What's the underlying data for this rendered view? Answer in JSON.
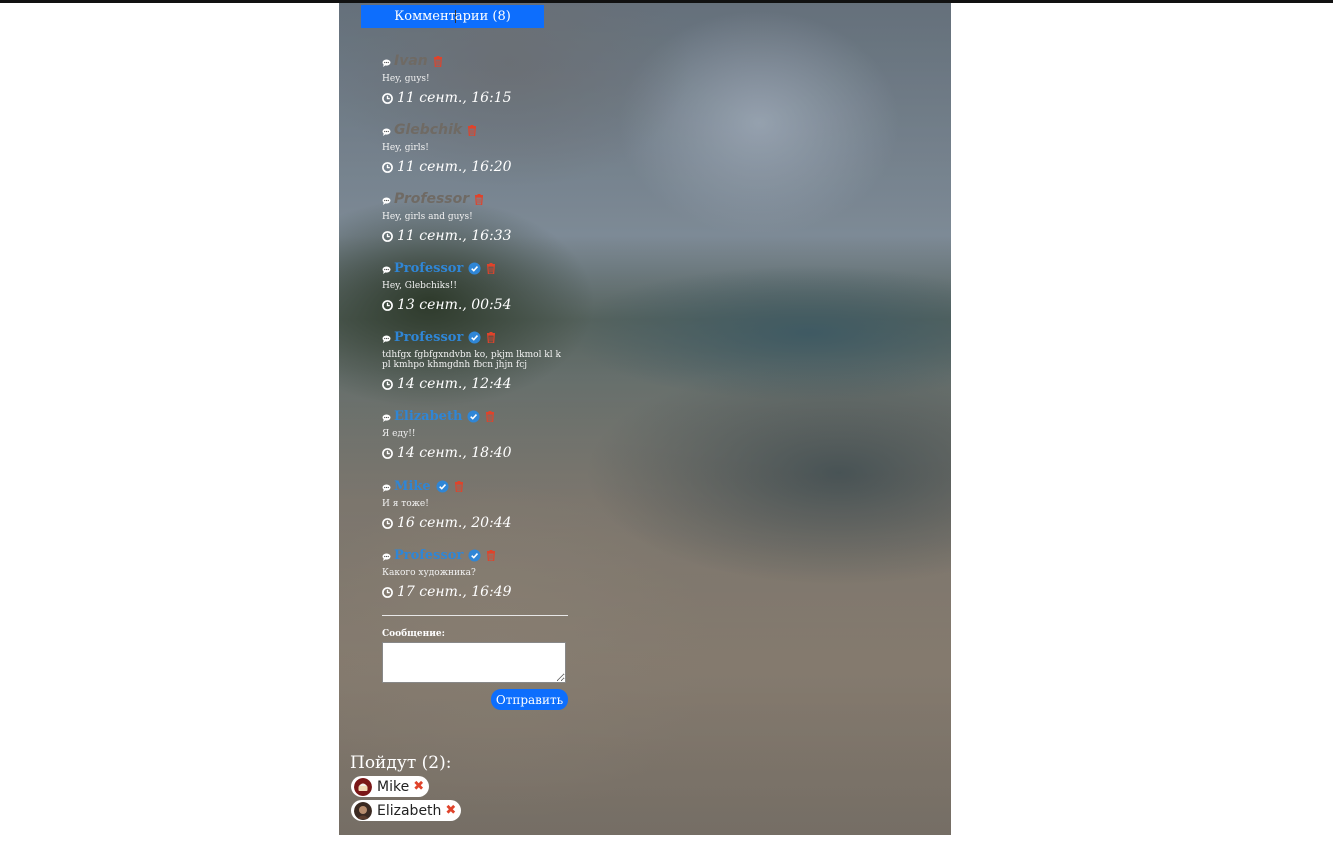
{
  "comments_tab": {
    "label_a": "Коммент",
    "label_b": "арии (8)"
  },
  "comments": [
    {
      "name": "Ivan",
      "verified": false,
      "text": "Hey, guys!",
      "time": "11 сент., 16:15"
    },
    {
      "name": "Glebchik",
      "verified": false,
      "text": "Hey, girls!",
      "time": "11 сент., 16:20"
    },
    {
      "name": "Professor",
      "verified": false,
      "text": "Hey, girls and guys!",
      "time": "11 сент., 16:33"
    },
    {
      "name": "Professor",
      "verified": true,
      "text": "Hey, Glebchiks!!",
      "time": "13 сент., 00:54"
    },
    {
      "name": "Professor",
      "verified": true,
      "text": "tdhfgx fgbfgxndvbn ko, pkjm lkmol kl k pl kmhpo khmgdnh fbcn jhjn fcj",
      "time": "14 сент., 12:44"
    },
    {
      "name": "Elizabeth",
      "verified": true,
      "text": "Я еду!!",
      "time": "14 сент., 18:40"
    },
    {
      "name": "Mike",
      "verified": true,
      "text": "И я тоже!",
      "time": "16 сент., 20:44"
    },
    {
      "name": "Professor",
      "verified": true,
      "text": "Какого художника?",
      "time": "17 сент., 16:49"
    }
  ],
  "form": {
    "label": "Сообщение:",
    "value": "",
    "submit_label": "Отправить"
  },
  "going": {
    "title": "Пойдут (2):",
    "people": [
      {
        "name": "Mike"
      },
      {
        "name": "Elizabeth"
      }
    ]
  },
  "colors": {
    "accent": "#0d6efd",
    "verified_name": "#2f86d6",
    "delete": "#e0432b"
  }
}
